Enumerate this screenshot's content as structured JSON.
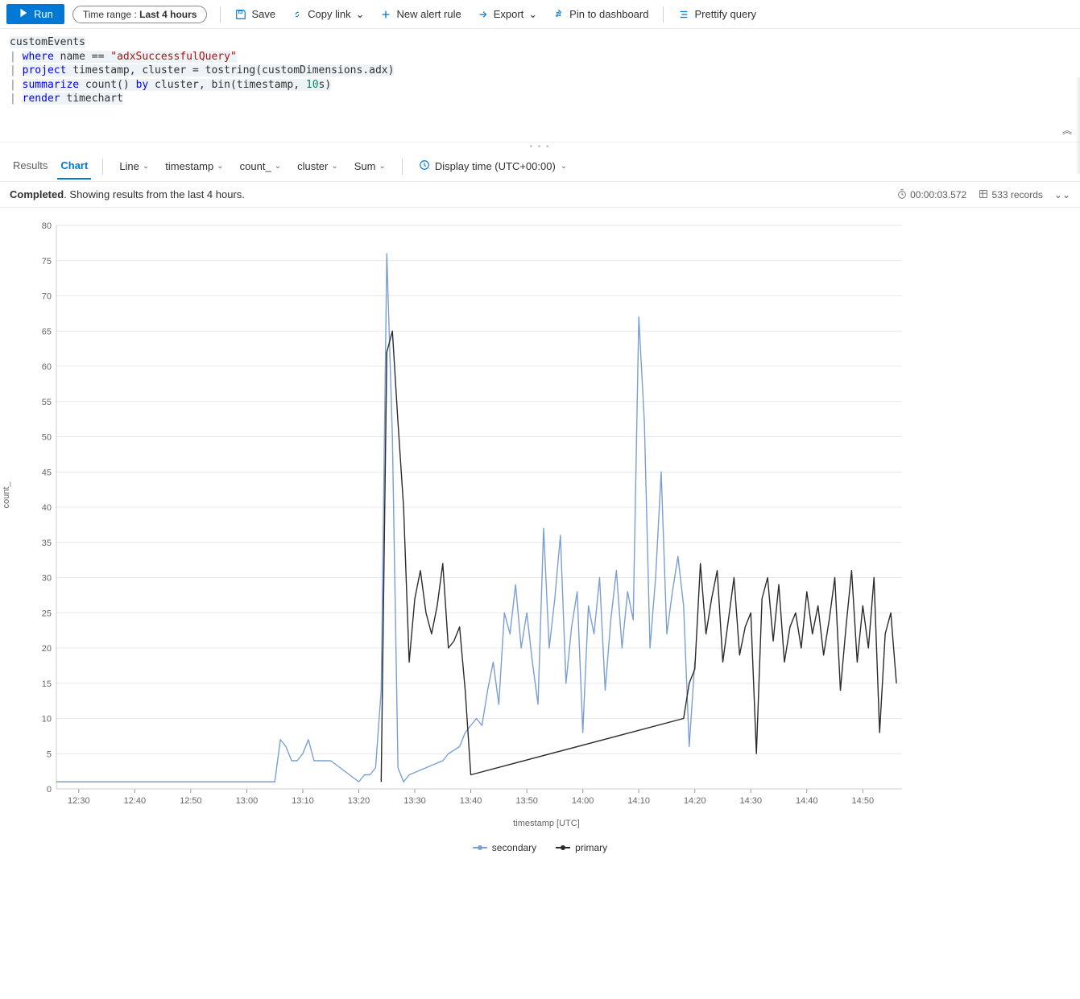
{
  "toolbar": {
    "run": "Run",
    "time_range_label": "Time range : ",
    "time_range_value": "Last 4 hours",
    "save": "Save",
    "copy_link": "Copy link",
    "new_alert": "New alert rule",
    "export": "Export",
    "pin": "Pin to dashboard",
    "prettify": "Prettify query"
  },
  "query": {
    "l1": "customEvents",
    "l2_kw": "where",
    "l2_rest": " name == ",
    "l2_str": "\"adxSuccessfulQuery\"",
    "l3_kw": "project",
    "l3_rest": " timestamp, cluster = tostring(customDimensions.adx)",
    "l4_kw": "summarize",
    "l4_mid": " count() ",
    "l4_by": "by",
    "l4_rest": " cluster, bin(timestamp, ",
    "l4_num": "10",
    "l4_tail": "s)",
    "l5_kw": "render",
    "l5_rest": " timechart"
  },
  "tabs": {
    "results": "Results",
    "chart": "Chart"
  },
  "dropdowns": {
    "chart_type": "Line",
    "x": "timestamp",
    "y": "count_",
    "split": "cluster",
    "agg": "Sum",
    "display_time": "Display time (UTC+00:00)"
  },
  "status": {
    "completed": "Completed",
    "text": ". Showing results from the last 4 hours.",
    "duration": "00:00:03.572",
    "records": "533 records"
  },
  "chart_axis": {
    "ylabel": "count_",
    "xlabel": "timestamp [UTC]"
  },
  "legend": {
    "secondary": "secondary",
    "primary": "primary"
  },
  "colors": {
    "secondary": "#7a9fd4",
    "primary": "#2b2b2b"
  },
  "chart_data": {
    "type": "line",
    "title": "",
    "xlabel": "timestamp [UTC]",
    "ylabel": "count_",
    "ylim": [
      0,
      80
    ],
    "x_ticks": [
      "12:30",
      "12:40",
      "12:50",
      "13:00",
      "13:10",
      "13:20",
      "13:30",
      "13:40",
      "13:50",
      "14:00",
      "14:10",
      "14:20",
      "14:30",
      "14:40",
      "14:50"
    ],
    "y_ticks": [
      0,
      5,
      10,
      15,
      20,
      25,
      30,
      35,
      40,
      45,
      50,
      55,
      60,
      65,
      70,
      75,
      80
    ],
    "x_range_minutes": [
      746,
      897
    ],
    "series": [
      {
        "name": "secondary",
        "color": "#7a9fd4",
        "points": [
          [
            746,
            1
          ],
          [
            770,
            1
          ],
          [
            785,
            1
          ],
          [
            786,
            7
          ],
          [
            787,
            6
          ],
          [
            788,
            4
          ],
          [
            789,
            4
          ],
          [
            790,
            5
          ],
          [
            791,
            7
          ],
          [
            792,
            4
          ],
          [
            795,
            4
          ],
          [
            800,
            1
          ],
          [
            801,
            2
          ],
          [
            802,
            2
          ],
          [
            803,
            3
          ],
          [
            804,
            14
          ],
          [
            805,
            76
          ],
          [
            806,
            50
          ],
          [
            807,
            3
          ],
          [
            808,
            1
          ],
          [
            809,
            2
          ],
          [
            815,
            4
          ],
          [
            816,
            5
          ],
          [
            818,
            6
          ],
          [
            819,
            8
          ],
          [
            820,
            9
          ],
          [
            821,
            10
          ],
          [
            822,
            9
          ],
          [
            823,
            14
          ],
          [
            824,
            18
          ],
          [
            825,
            12
          ],
          [
            826,
            25
          ],
          [
            827,
            22
          ],
          [
            828,
            29
          ],
          [
            829,
            20
          ],
          [
            830,
            25
          ],
          [
            831,
            18
          ],
          [
            832,
            12
          ],
          [
            833,
            37
          ],
          [
            834,
            20
          ],
          [
            835,
            27
          ],
          [
            836,
            36
          ],
          [
            837,
            15
          ],
          [
            838,
            23
          ],
          [
            839,
            28
          ],
          [
            840,
            8
          ],
          [
            841,
            26
          ],
          [
            842,
            22
          ],
          [
            843,
            30
          ],
          [
            844,
            14
          ],
          [
            845,
            24
          ],
          [
            846,
            31
          ],
          [
            847,
            20
          ],
          [
            848,
            28
          ],
          [
            849,
            24
          ],
          [
            850,
            67
          ],
          [
            851,
            52
          ],
          [
            852,
            20
          ],
          [
            853,
            30
          ],
          [
            854,
            45
          ],
          [
            855,
            22
          ],
          [
            856,
            28
          ],
          [
            857,
            33
          ],
          [
            858,
            26
          ],
          [
            859,
            6
          ],
          [
            860,
            18
          ]
        ]
      },
      {
        "name": "primary",
        "color": "#2b2b2b",
        "points": [
          [
            804,
            1
          ],
          [
            805,
            62
          ],
          [
            806,
            65
          ],
          [
            807,
            52
          ],
          [
            808,
            40
          ],
          [
            809,
            18
          ],
          [
            810,
            27
          ],
          [
            811,
            31
          ],
          [
            812,
            25
          ],
          [
            813,
            22
          ],
          [
            814,
            26
          ],
          [
            815,
            32
          ],
          [
            816,
            20
          ],
          [
            817,
            21
          ],
          [
            818,
            23
          ],
          [
            819,
            14
          ],
          [
            820,
            2
          ],
          [
            858,
            10
          ],
          [
            859,
            15
          ],
          [
            860,
            17
          ],
          [
            861,
            32
          ],
          [
            862,
            22
          ],
          [
            863,
            27
          ],
          [
            864,
            31
          ],
          [
            865,
            18
          ],
          [
            866,
            24
          ],
          [
            867,
            30
          ],
          [
            868,
            19
          ],
          [
            869,
            23
          ],
          [
            870,
            25
          ],
          [
            871,
            5
          ],
          [
            872,
            27
          ],
          [
            873,
            30
          ],
          [
            874,
            21
          ],
          [
            875,
            29
          ],
          [
            876,
            18
          ],
          [
            877,
            23
          ],
          [
            878,
            25
          ],
          [
            879,
            20
          ],
          [
            880,
            28
          ],
          [
            881,
            22
          ],
          [
            882,
            26
          ],
          [
            883,
            19
          ],
          [
            884,
            24
          ],
          [
            885,
            30
          ],
          [
            886,
            14
          ],
          [
            887,
            23
          ],
          [
            888,
            31
          ],
          [
            889,
            18
          ],
          [
            890,
            26
          ],
          [
            891,
            20
          ],
          [
            892,
            30
          ],
          [
            893,
            8
          ],
          [
            894,
            22
          ],
          [
            895,
            25
          ],
          [
            896,
            15
          ]
        ]
      }
    ]
  }
}
